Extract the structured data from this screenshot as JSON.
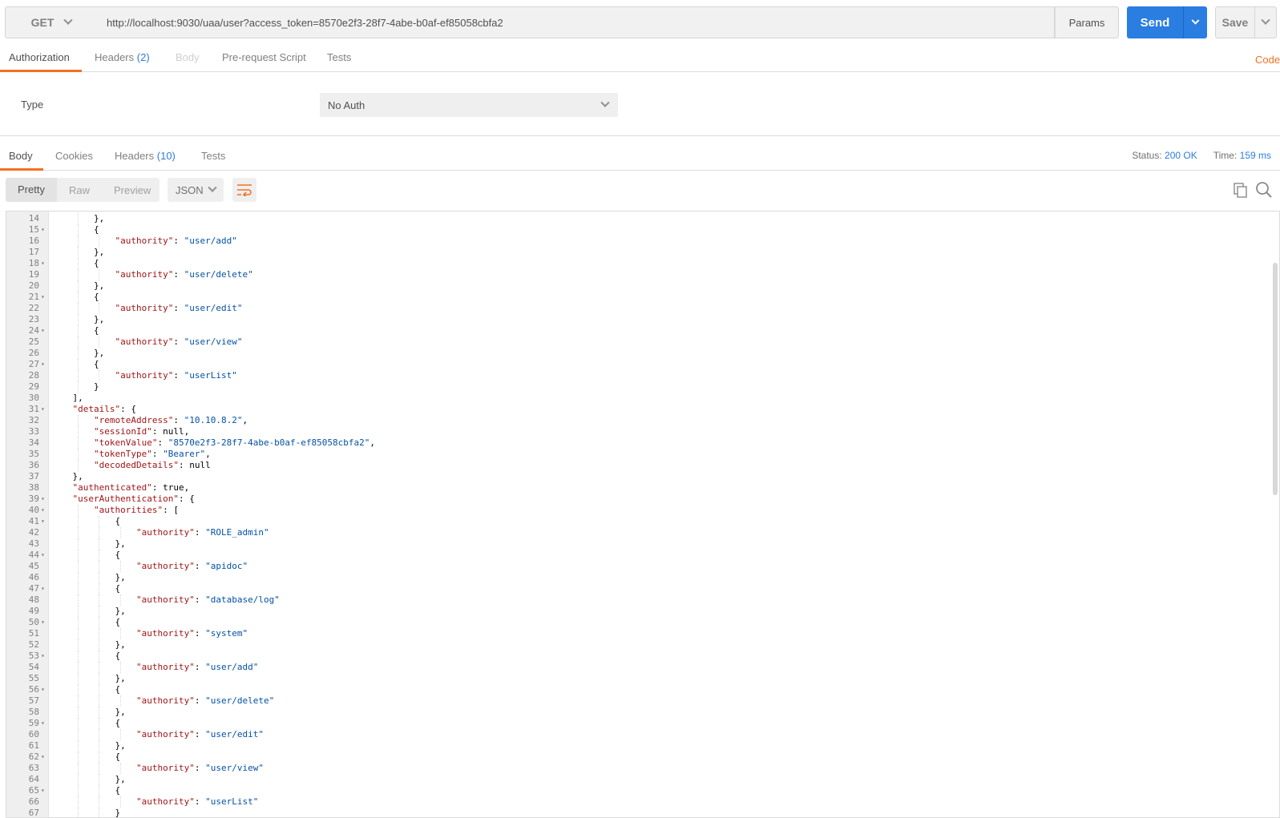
{
  "request": {
    "method": "GET",
    "url": "http://localhost:9030/uaa/user?access_token=8570e2f3-28f7-4abe-b0af-ef85058cbfa2",
    "params_label": "Params",
    "send_label": "Send",
    "save_label": "Save"
  },
  "request_tabs": {
    "authorization": "Authorization",
    "headers": "Headers",
    "headers_count": "(2)",
    "body": "Body",
    "prerequest": "Pre-request Script",
    "tests": "Tests",
    "code": "Code"
  },
  "auth": {
    "type_label": "Type",
    "type_value": "No Auth"
  },
  "response_tabs": {
    "body": "Body",
    "cookies": "Cookies",
    "headers": "Headers",
    "headers_count": "(10)",
    "tests": "Tests",
    "status_label": "Status:",
    "status_value": "200 OK",
    "time_label": "Time:",
    "time_value": "159 ms"
  },
  "view": {
    "pretty": "Pretty",
    "raw": "Raw",
    "preview": "Preview",
    "format": "JSON"
  },
  "colors": {
    "accent": "#f47023",
    "send": "#2a7de1",
    "json_key": "#a31515",
    "json_string": "#0451a5"
  },
  "code_lines": [
    {
      "n": "14",
      "fold": false,
      "indent": 2,
      "parts": [
        [
          "p",
          "},"
        ]
      ]
    },
    {
      "n": "15",
      "fold": true,
      "indent": 2,
      "parts": [
        [
          "p",
          "{"
        ]
      ]
    },
    {
      "n": "16",
      "fold": false,
      "indent": 3,
      "parts": [
        [
          "k",
          "\"authority\""
        ],
        [
          "p",
          ": "
        ],
        [
          "s",
          "\"user/add\""
        ]
      ]
    },
    {
      "n": "17",
      "fold": false,
      "indent": 2,
      "parts": [
        [
          "p",
          "},"
        ]
      ]
    },
    {
      "n": "18",
      "fold": true,
      "indent": 2,
      "parts": [
        [
          "p",
          "{"
        ]
      ]
    },
    {
      "n": "19",
      "fold": false,
      "indent": 3,
      "parts": [
        [
          "k",
          "\"authority\""
        ],
        [
          "p",
          ": "
        ],
        [
          "s",
          "\"user/delete\""
        ]
      ]
    },
    {
      "n": "20",
      "fold": false,
      "indent": 2,
      "parts": [
        [
          "p",
          "},"
        ]
      ]
    },
    {
      "n": "21",
      "fold": true,
      "indent": 2,
      "parts": [
        [
          "p",
          "{"
        ]
      ]
    },
    {
      "n": "22",
      "fold": false,
      "indent": 3,
      "parts": [
        [
          "k",
          "\"authority\""
        ],
        [
          "p",
          ": "
        ],
        [
          "s",
          "\"user/edit\""
        ]
      ]
    },
    {
      "n": "23",
      "fold": false,
      "indent": 2,
      "parts": [
        [
          "p",
          "},"
        ]
      ]
    },
    {
      "n": "24",
      "fold": true,
      "indent": 2,
      "parts": [
        [
          "p",
          "{"
        ]
      ]
    },
    {
      "n": "25",
      "fold": false,
      "indent": 3,
      "parts": [
        [
          "k",
          "\"authority\""
        ],
        [
          "p",
          ": "
        ],
        [
          "s",
          "\"user/view\""
        ]
      ]
    },
    {
      "n": "26",
      "fold": false,
      "indent": 2,
      "parts": [
        [
          "p",
          "},"
        ]
      ]
    },
    {
      "n": "27",
      "fold": true,
      "indent": 2,
      "parts": [
        [
          "p",
          "{"
        ]
      ]
    },
    {
      "n": "28",
      "fold": false,
      "indent": 3,
      "parts": [
        [
          "k",
          "\"authority\""
        ],
        [
          "p",
          ": "
        ],
        [
          "s",
          "\"userList\""
        ]
      ]
    },
    {
      "n": "29",
      "fold": false,
      "indent": 2,
      "parts": [
        [
          "p",
          "}"
        ]
      ]
    },
    {
      "n": "30",
      "fold": false,
      "indent": 1,
      "parts": [
        [
          "p",
          "],"
        ]
      ]
    },
    {
      "n": "31",
      "fold": true,
      "indent": 1,
      "parts": [
        [
          "k",
          "\"details\""
        ],
        [
          "p",
          ": {"
        ]
      ]
    },
    {
      "n": "32",
      "fold": false,
      "indent": 2,
      "parts": [
        [
          "k",
          "\"remoteAddress\""
        ],
        [
          "p",
          ": "
        ],
        [
          "s",
          "\"10.10.8.2\""
        ],
        [
          "p",
          ","
        ]
      ]
    },
    {
      "n": "33",
      "fold": false,
      "indent": 2,
      "parts": [
        [
          "k",
          "\"sessionId\""
        ],
        [
          "p",
          ": null,"
        ]
      ]
    },
    {
      "n": "34",
      "fold": false,
      "indent": 2,
      "parts": [
        [
          "k",
          "\"tokenValue\""
        ],
        [
          "p",
          ": "
        ],
        [
          "s",
          "\"8570e2f3-28f7-4abe-b0af-ef85058cbfa2\""
        ],
        [
          "p",
          ","
        ]
      ]
    },
    {
      "n": "35",
      "fold": false,
      "indent": 2,
      "parts": [
        [
          "k",
          "\"tokenType\""
        ],
        [
          "p",
          ": "
        ],
        [
          "s",
          "\"Bearer\""
        ],
        [
          "p",
          ","
        ]
      ]
    },
    {
      "n": "36",
      "fold": false,
      "indent": 2,
      "parts": [
        [
          "k",
          "\"decodedDetails\""
        ],
        [
          "p",
          ": null"
        ]
      ]
    },
    {
      "n": "37",
      "fold": false,
      "indent": 1,
      "parts": [
        [
          "p",
          "},"
        ]
      ]
    },
    {
      "n": "38",
      "fold": false,
      "indent": 1,
      "parts": [
        [
          "k",
          "\"authenticated\""
        ],
        [
          "p",
          ": true,"
        ]
      ]
    },
    {
      "n": "39",
      "fold": true,
      "indent": 1,
      "parts": [
        [
          "k",
          "\"userAuthentication\""
        ],
        [
          "p",
          ": {"
        ]
      ]
    },
    {
      "n": "40",
      "fold": true,
      "indent": 2,
      "parts": [
        [
          "k",
          "\"authorities\""
        ],
        [
          "p",
          ": ["
        ]
      ]
    },
    {
      "n": "41",
      "fold": true,
      "indent": 3,
      "parts": [
        [
          "p",
          "{"
        ]
      ]
    },
    {
      "n": "42",
      "fold": false,
      "indent": 4,
      "parts": [
        [
          "k",
          "\"authority\""
        ],
        [
          "p",
          ": "
        ],
        [
          "s",
          "\"ROLE_admin\""
        ]
      ]
    },
    {
      "n": "43",
      "fold": false,
      "indent": 3,
      "parts": [
        [
          "p",
          "},"
        ]
      ]
    },
    {
      "n": "44",
      "fold": true,
      "indent": 3,
      "parts": [
        [
          "p",
          "{"
        ]
      ]
    },
    {
      "n": "45",
      "fold": false,
      "indent": 4,
      "parts": [
        [
          "k",
          "\"authority\""
        ],
        [
          "p",
          ": "
        ],
        [
          "s",
          "\"apidoc\""
        ]
      ]
    },
    {
      "n": "46",
      "fold": false,
      "indent": 3,
      "parts": [
        [
          "p",
          "},"
        ]
      ]
    },
    {
      "n": "47",
      "fold": true,
      "indent": 3,
      "parts": [
        [
          "p",
          "{"
        ]
      ]
    },
    {
      "n": "48",
      "fold": false,
      "indent": 4,
      "parts": [
        [
          "k",
          "\"authority\""
        ],
        [
          "p",
          ": "
        ],
        [
          "s",
          "\"database/log\""
        ]
      ]
    },
    {
      "n": "49",
      "fold": false,
      "indent": 3,
      "parts": [
        [
          "p",
          "},"
        ]
      ]
    },
    {
      "n": "50",
      "fold": true,
      "indent": 3,
      "parts": [
        [
          "p",
          "{"
        ]
      ]
    },
    {
      "n": "51",
      "fold": false,
      "indent": 4,
      "parts": [
        [
          "k",
          "\"authority\""
        ],
        [
          "p",
          ": "
        ],
        [
          "s",
          "\"system\""
        ]
      ]
    },
    {
      "n": "52",
      "fold": false,
      "indent": 3,
      "parts": [
        [
          "p",
          "},"
        ]
      ]
    },
    {
      "n": "53",
      "fold": true,
      "indent": 3,
      "parts": [
        [
          "p",
          "{"
        ]
      ]
    },
    {
      "n": "54",
      "fold": false,
      "indent": 4,
      "parts": [
        [
          "k",
          "\"authority\""
        ],
        [
          "p",
          ": "
        ],
        [
          "s",
          "\"user/add\""
        ]
      ]
    },
    {
      "n": "55",
      "fold": false,
      "indent": 3,
      "parts": [
        [
          "p",
          "},"
        ]
      ]
    },
    {
      "n": "56",
      "fold": true,
      "indent": 3,
      "parts": [
        [
          "p",
          "{"
        ]
      ]
    },
    {
      "n": "57",
      "fold": false,
      "indent": 4,
      "parts": [
        [
          "k",
          "\"authority\""
        ],
        [
          "p",
          ": "
        ],
        [
          "s",
          "\"user/delete\""
        ]
      ]
    },
    {
      "n": "58",
      "fold": false,
      "indent": 3,
      "parts": [
        [
          "p",
          "},"
        ]
      ]
    },
    {
      "n": "59",
      "fold": true,
      "indent": 3,
      "parts": [
        [
          "p",
          "{"
        ]
      ]
    },
    {
      "n": "60",
      "fold": false,
      "indent": 4,
      "parts": [
        [
          "k",
          "\"authority\""
        ],
        [
          "p",
          ": "
        ],
        [
          "s",
          "\"user/edit\""
        ]
      ]
    },
    {
      "n": "61",
      "fold": false,
      "indent": 3,
      "parts": [
        [
          "p",
          "},"
        ]
      ]
    },
    {
      "n": "62",
      "fold": true,
      "indent": 3,
      "parts": [
        [
          "p",
          "{"
        ]
      ]
    },
    {
      "n": "63",
      "fold": false,
      "indent": 4,
      "parts": [
        [
          "k",
          "\"authority\""
        ],
        [
          "p",
          ": "
        ],
        [
          "s",
          "\"user/view\""
        ]
      ]
    },
    {
      "n": "64",
      "fold": false,
      "indent": 3,
      "parts": [
        [
          "p",
          "},"
        ]
      ]
    },
    {
      "n": "65",
      "fold": true,
      "indent": 3,
      "parts": [
        [
          "p",
          "{"
        ]
      ]
    },
    {
      "n": "66",
      "fold": false,
      "indent": 4,
      "parts": [
        [
          "k",
          "\"authority\""
        ],
        [
          "p",
          ": "
        ],
        [
          "s",
          "\"userList\""
        ]
      ]
    },
    {
      "n": "67",
      "fold": false,
      "indent": 3,
      "parts": [
        [
          "p",
          "}"
        ]
      ]
    }
  ]
}
